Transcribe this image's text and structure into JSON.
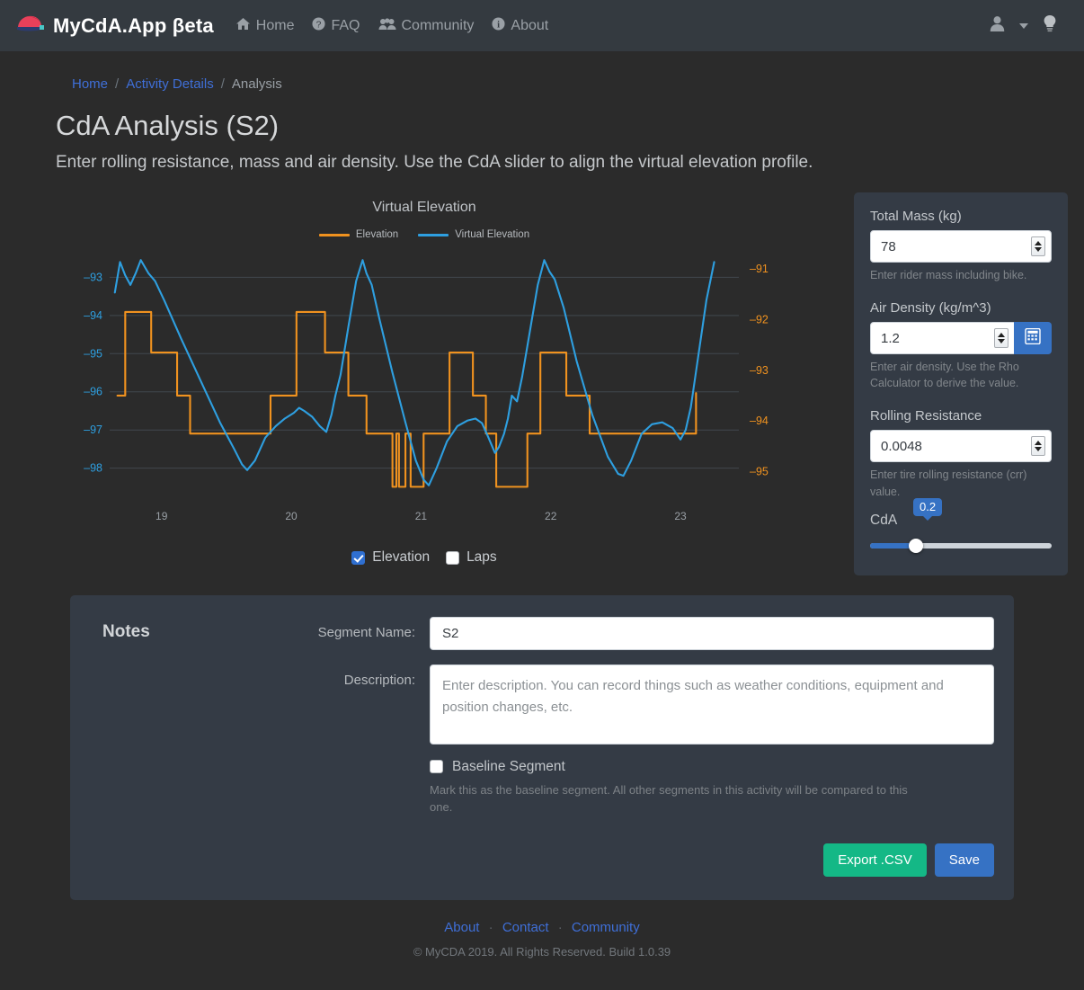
{
  "navbar": {
    "brand": "MyCdA.App βeta",
    "logo_icon": "cycling-cap-logo-icon",
    "links": [
      {
        "label": "Home",
        "icon": "home-icon"
      },
      {
        "label": "FAQ",
        "icon": "question-circle-icon"
      },
      {
        "label": "Community",
        "icon": "users-icon"
      },
      {
        "label": "About",
        "icon": "info-circle-icon"
      }
    ],
    "user_icon": "user-icon",
    "caret_icon": "chevron-down-icon",
    "bulb_icon": "lightbulb-icon"
  },
  "breadcrumb": {
    "items": [
      "Home",
      "Activity Details",
      "Analysis"
    ],
    "separator": "/"
  },
  "header": {
    "title": "CdA Analysis (S2)",
    "lead": "Enter rolling resistance, mass and air density. Use the CdA slider to align the virtual elevation profile."
  },
  "chart_data": {
    "type": "line",
    "title": "Virtual Elevation",
    "xlabel": "",
    "ylabel": "",
    "grid": true,
    "legend_position": "top",
    "x": [
      19,
      20,
      21,
      22,
      23
    ],
    "xtick_labels": [
      "19",
      "20",
      "21",
      "22",
      "23"
    ],
    "xlim": [
      18.6,
      23.45
    ],
    "left_axis": {
      "name": "Virtual Elevation",
      "color": "#2e9fe0",
      "ticks": [
        -93,
        -94,
        -95,
        -96,
        -97,
        -98
      ],
      "tick_labels": [
        "–93",
        "–94",
        "–95",
        "–96",
        "–97",
        "–98"
      ],
      "ylim": [
        -98.62,
        -92.45
      ]
    },
    "right_axis": {
      "name": "Elevation",
      "color": "#f0921f",
      "ticks": [
        -91,
        -92,
        -93,
        -94,
        -95
      ],
      "tick_labels": [
        "–91",
        "–92",
        "–93",
        "–94",
        "–95"
      ],
      "ylim": [
        -95.4,
        -90.75
      ]
    },
    "series": [
      {
        "name": "Elevation",
        "color": "#f0921f",
        "axis": "right",
        "style": "step",
        "points": [
          [
            18.66,
            -93.5
          ],
          [
            18.72,
            -93.5
          ],
          [
            18.72,
            -91.85
          ],
          [
            18.92,
            -91.85
          ],
          [
            18.92,
            -92.65
          ],
          [
            19.12,
            -92.65
          ],
          [
            19.12,
            -93.5
          ],
          [
            19.22,
            -93.5
          ],
          [
            19.22,
            -94.25
          ],
          [
            19.84,
            -94.25
          ],
          [
            19.84,
            -93.5
          ],
          [
            20.04,
            -93.5
          ],
          [
            20.04,
            -91.85
          ],
          [
            20.26,
            -91.85
          ],
          [
            20.26,
            -92.65
          ],
          [
            20.44,
            -92.65
          ],
          [
            20.44,
            -93.5
          ],
          [
            20.58,
            -93.5
          ],
          [
            20.58,
            -94.25
          ],
          [
            20.78,
            -94.25
          ],
          [
            20.78,
            -95.3
          ],
          [
            20.81,
            -95.3
          ],
          [
            20.81,
            -94.25
          ],
          [
            20.83,
            -94.25
          ],
          [
            20.83,
            -95.3
          ],
          [
            20.88,
            -95.3
          ],
          [
            20.88,
            -94.25
          ],
          [
            20.92,
            -94.25
          ],
          [
            20.92,
            -95.3
          ],
          [
            21.02,
            -95.3
          ],
          [
            21.02,
            -94.25
          ],
          [
            21.22,
            -94.25
          ],
          [
            21.22,
            -92.65
          ],
          [
            21.4,
            -92.65
          ],
          [
            21.4,
            -93.5
          ],
          [
            21.5,
            -93.5
          ],
          [
            21.5,
            -94.25
          ],
          [
            21.58,
            -94.25
          ],
          [
            21.58,
            -95.3
          ],
          [
            21.82,
            -95.3
          ],
          [
            21.82,
            -94.25
          ],
          [
            21.92,
            -94.25
          ],
          [
            21.92,
            -92.65
          ],
          [
            22.12,
            -92.65
          ],
          [
            22.12,
            -93.5
          ],
          [
            22.3,
            -93.5
          ],
          [
            22.3,
            -94.25
          ],
          [
            23.12,
            -94.25
          ],
          [
            23.12,
            -93.45
          ]
        ]
      },
      {
        "name": "Virtual Elevation",
        "color": "#2e9fe0",
        "axis": "left",
        "style": "smooth",
        "points": [
          [
            18.64,
            -93.4
          ],
          [
            18.68,
            -92.6
          ],
          [
            18.72,
            -92.95
          ],
          [
            18.76,
            -93.2
          ],
          [
            18.8,
            -92.9
          ],
          [
            18.84,
            -92.55
          ],
          [
            18.9,
            -92.9
          ],
          [
            18.95,
            -93.1
          ],
          [
            19.02,
            -93.6
          ],
          [
            19.15,
            -94.6
          ],
          [
            19.3,
            -95.7
          ],
          [
            19.45,
            -96.8
          ],
          [
            19.56,
            -97.5
          ],
          [
            19.62,
            -97.9
          ],
          [
            19.66,
            -98.05
          ],
          [
            19.72,
            -97.8
          ],
          [
            19.8,
            -97.2
          ],
          [
            19.88,
            -96.9
          ],
          [
            19.95,
            -96.7
          ],
          [
            20.02,
            -96.55
          ],
          [
            20.06,
            -96.42
          ],
          [
            20.1,
            -96.5
          ],
          [
            20.16,
            -96.65
          ],
          [
            20.22,
            -96.9
          ],
          [
            20.27,
            -97.05
          ],
          [
            20.31,
            -96.6
          ],
          [
            20.34,
            -96.1
          ],
          [
            20.38,
            -95.55
          ],
          [
            20.44,
            -94.3
          ],
          [
            20.5,
            -93.1
          ],
          [
            20.55,
            -92.55
          ],
          [
            20.58,
            -92.9
          ],
          [
            20.62,
            -93.2
          ],
          [
            20.68,
            -94.1
          ],
          [
            20.78,
            -95.5
          ],
          [
            20.88,
            -96.8
          ],
          [
            20.96,
            -97.8
          ],
          [
            21.02,
            -98.3
          ],
          [
            21.06,
            -98.45
          ],
          [
            21.12,
            -98.0
          ],
          [
            21.2,
            -97.3
          ],
          [
            21.28,
            -96.9
          ],
          [
            21.36,
            -96.75
          ],
          [
            21.42,
            -96.7
          ],
          [
            21.47,
            -96.82
          ],
          [
            21.52,
            -97.2
          ],
          [
            21.57,
            -97.6
          ],
          [
            21.6,
            -97.45
          ],
          [
            21.64,
            -97.1
          ],
          [
            21.67,
            -96.7
          ],
          [
            21.7,
            -96.1
          ],
          [
            21.74,
            -96.25
          ],
          [
            21.78,
            -95.6
          ],
          [
            21.84,
            -94.4
          ],
          [
            21.9,
            -93.2
          ],
          [
            21.95,
            -92.55
          ],
          [
            21.99,
            -92.85
          ],
          [
            22.03,
            -93.05
          ],
          [
            22.1,
            -93.8
          ],
          [
            22.2,
            -95.2
          ],
          [
            22.32,
            -96.6
          ],
          [
            22.44,
            -97.7
          ],
          [
            22.52,
            -98.15
          ],
          [
            22.56,
            -98.2
          ],
          [
            22.62,
            -97.8
          ],
          [
            22.7,
            -97.1
          ],
          [
            22.78,
            -96.85
          ],
          [
            22.86,
            -96.8
          ],
          [
            22.94,
            -96.95
          ],
          [
            23.0,
            -97.25
          ],
          [
            23.04,
            -97.0
          ],
          [
            23.08,
            -96.4
          ],
          [
            23.14,
            -95.0
          ],
          [
            23.2,
            -93.6
          ],
          [
            23.26,
            -92.6
          ]
        ]
      }
    ],
    "checkboxes": [
      {
        "label": "Elevation",
        "checked": true
      },
      {
        "label": "Laps",
        "checked": false
      }
    ]
  },
  "side_panel": {
    "total_mass": {
      "label": "Total Mass (kg)",
      "value": "78",
      "help": "Enter rider mass including bike."
    },
    "air_density": {
      "label": "Air Density (kg/m^3)",
      "value": "1.2",
      "help": "Enter air density. Use the Rho Calculator to derive the value.",
      "calc_icon": "calculator-icon"
    },
    "rolling_resistance": {
      "label": "Rolling Resistance",
      "value": "0.0048",
      "help": "Enter tire rolling resistance (crr) value."
    },
    "cda": {
      "label": "CdA",
      "value": "0.2",
      "fill_percent": 25
    },
    "accent_color": "#3672c4"
  },
  "notes": {
    "title": "Notes",
    "segment_name": {
      "label": "Segment Name:",
      "value": "S2"
    },
    "description": {
      "label": "Description:",
      "placeholder": "Enter description. You can record things such as weather conditions, equipment and position changes, etc."
    },
    "baseline": {
      "label": "Baseline Segment",
      "checked": false,
      "help": "Mark this as the baseline segment. All other segments in this activity will be compared to this one."
    },
    "export_label": "Export .CSV",
    "save_label": "Save",
    "export_color": "#14b886",
    "save_color": "#3672c4"
  },
  "footer": {
    "links": [
      "About",
      "Contact",
      "Community"
    ],
    "separator": "·",
    "copyright": "© MyCDA 2019. All Rights Reserved. Build 1.0.39"
  }
}
